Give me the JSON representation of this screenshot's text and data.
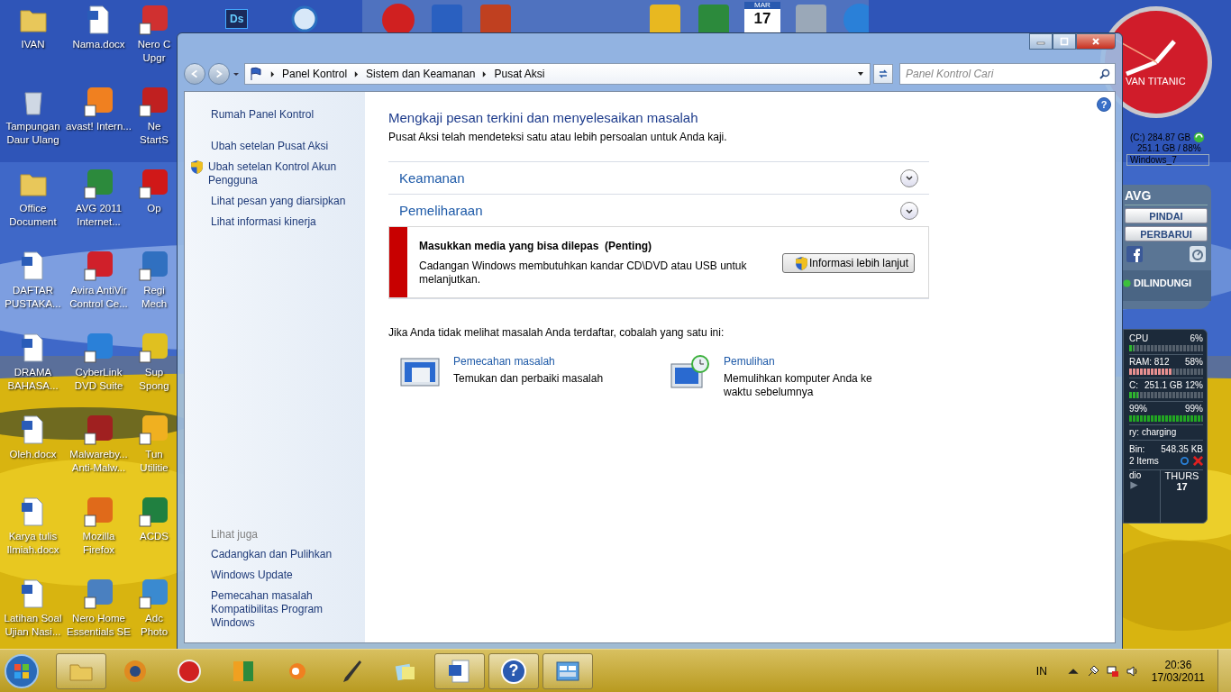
{
  "desktop": {
    "icons": [
      {
        "label": "IVAN",
        "kind": "folder"
      },
      {
        "label": "Tampungan Daur Ulang",
        "kind": "bin"
      },
      {
        "label": "Office Document",
        "kind": "folder"
      },
      {
        "label": "DAFTAR PUSTAKA...",
        "kind": "document"
      },
      {
        "label": "DRAMA BAHASA...",
        "kind": "document"
      },
      {
        "label": "Oleh.docx",
        "kind": "document"
      },
      {
        "label": "Karya tulis Ilmiah.docx",
        "kind": "document"
      },
      {
        "label": "Latihan Soal Ujian Nasi...",
        "kind": "document"
      },
      {
        "label": "Nama.docx",
        "kind": "document"
      },
      {
        "label": "avast! Intern...",
        "kind": "shortcut",
        "color": "#f08020"
      },
      {
        "label": "AVG 2011 Internet...",
        "kind": "shortcut",
        "color": "#2c8a3c"
      },
      {
        "label": "Avira AntiVir Control Ce...",
        "kind": "shortcut",
        "color": "#d0202a"
      },
      {
        "label": "CyberLink DVD Suite",
        "kind": "shortcut",
        "color": "#2a80d8"
      },
      {
        "label": "Malwareby... Anti-Malw...",
        "kind": "shortcut",
        "color": "#a02020"
      },
      {
        "label": "Mozilla Firefox",
        "kind": "shortcut",
        "color": "#e06a1a"
      },
      {
        "label": "Nero Home Essentials SE",
        "kind": "shortcut",
        "color": "#4a80c0"
      },
      {
        "label": "Nero C\nUpgr",
        "kind": "shortcut",
        "color": "#d03030"
      },
      {
        "label": "Ne\nStartS",
        "kind": "shortcut",
        "color": "#c02020"
      },
      {
        "label": "Op",
        "kind": "shortcut",
        "color": "#d01818"
      },
      {
        "label": "Regi\nMech",
        "kind": "shortcut",
        "color": "#3070c0"
      },
      {
        "label": "Sup\nSpong",
        "kind": "shortcut",
        "color": "#e0c020"
      },
      {
        "label": "Tun\nUtilitie",
        "kind": "shortcut",
        "color": "#f0b020"
      },
      {
        "label": "ACDS",
        "kind": "shortcut",
        "color": "#208040"
      },
      {
        "label": "Adc\nPhoto",
        "kind": "shortcut",
        "color": "#3a8ad0"
      }
    ],
    "top_icons": [
      {
        "kind": "badge",
        "label": "Ds"
      },
      {
        "kind": "round"
      }
    ],
    "dock": [
      {
        "kind": "round",
        "color": "#d02020"
      },
      {
        "kind": "square",
        "color": "#2a60c0"
      },
      {
        "kind": "square",
        "color": "#c04020"
      },
      {
        "kind": "gap"
      },
      {
        "kind": "square",
        "color": "#e8b820"
      },
      {
        "kind": "square",
        "color": "#2c8a3c"
      },
      {
        "kind": "calendar",
        "month": "MAR",
        "day": "17"
      },
      {
        "kind": "square",
        "color": "#9aa8b8"
      },
      {
        "kind": "round",
        "color": "#2a80d8"
      }
    ]
  },
  "window": {
    "address": [
      "Panel Kontrol",
      "Sistem dan Keamanan",
      "Pusat Aksi"
    ],
    "search": {
      "placeholder": "Panel Kontrol Cari"
    },
    "help": "?",
    "sidebar": {
      "home": "Rumah Panel Kontrol",
      "items": [
        {
          "label": "Ubah setelan Pusat Aksi",
          "shield": false
        },
        {
          "label": "Ubah setelan Kontrol Akun Pengguna",
          "shield": true
        },
        {
          "label": "Lihat pesan yang diarsipkan",
          "shield": false
        },
        {
          "label": "Lihat informasi kinerja",
          "shield": false
        }
      ],
      "see_also": {
        "title": "Lihat juga",
        "items": [
          "Cadangkan dan Pulihkan",
          "Windows Update",
          "Pemecahan masalah Kompatibilitas Program Windows"
        ]
      }
    },
    "main": {
      "title": "Mengkaji pesan terkini dan menyelesaikan masalah",
      "subtitle": "Pusat Aksi telah mendeteksi satu atau lebih persoalan untuk Anda kaji.",
      "sections": [
        {
          "title": "Keamanan",
          "expanded": false
        },
        {
          "title": "Pemeliharaan",
          "expanded": true,
          "message": {
            "title": "Masukkan media yang bisa dilepas  (Penting)",
            "text": "Cadangan Windows membutuhkan kandar CD\\DVD atau USB untuk melanjutkan.",
            "button": "Informasi lebih lanjut"
          }
        }
      ],
      "hint": "Jika Anda tidak melihat masalah Anda terdaftar, cobalah yang satu ini:",
      "tools": [
        {
          "kind": "troubleshoot",
          "link": "Pemecahan masalah",
          "text": "Temukan dan perbaiki masalah"
        },
        {
          "kind": "recovery",
          "link": "Pemulihan",
          "text": "Memulihkan komputer Anda ke waktu sebelumnya"
        }
      ]
    }
  },
  "gadgets": {
    "clock": {
      "label": "VAN TITANIC"
    },
    "drive": {
      "size": "(C:) 284.87 GB",
      "usage": "251.1 GB / 88%",
      "name": "Windows_7"
    },
    "avg": {
      "title": "AVG",
      "buttons": [
        "PINDAI",
        "PERBARUI"
      ],
      "status": "DILINDUNGI"
    },
    "monitor": {
      "rows": [
        {
          "label": "CPU",
          "value": "6%",
          "level": 0.06,
          "color": "#2fb52f"
        },
        {
          "label": "RAM: 812",
          "value": "58%",
          "level": 0.58,
          "color": "#e89090"
        },
        {
          "label": "C:",
          "value": "251.1 GB 12%",
          "level": 0.12,
          "color": "#2fb52f"
        },
        {
          "label": "99%",
          "value": "99%",
          "level": 0.99,
          "color": "#22a622"
        }
      ],
      "battery": "ry: charging",
      "bin_label": "Bin:",
      "bin_size": "548.35 KB",
      "bin_items": "2 Items",
      "radio": "dio",
      "day": "THURS",
      "date": "17"
    }
  },
  "taskbar": {
    "items": [
      {
        "kind": "explorer",
        "open": true
      },
      {
        "kind": "media",
        "open": false
      },
      {
        "kind": "nero",
        "open": false
      },
      {
        "kind": "avg",
        "open": false
      },
      {
        "kind": "avast",
        "open": false
      },
      {
        "kind": "brush",
        "open": false
      },
      {
        "kind": "notes",
        "open": false
      },
      {
        "kind": "word",
        "open": true
      },
      {
        "kind": "help",
        "open": true,
        "label": "?"
      },
      {
        "kind": "panel",
        "open": true
      }
    ],
    "language": "IN",
    "time": "20:36",
    "date": "17/03/2011"
  }
}
